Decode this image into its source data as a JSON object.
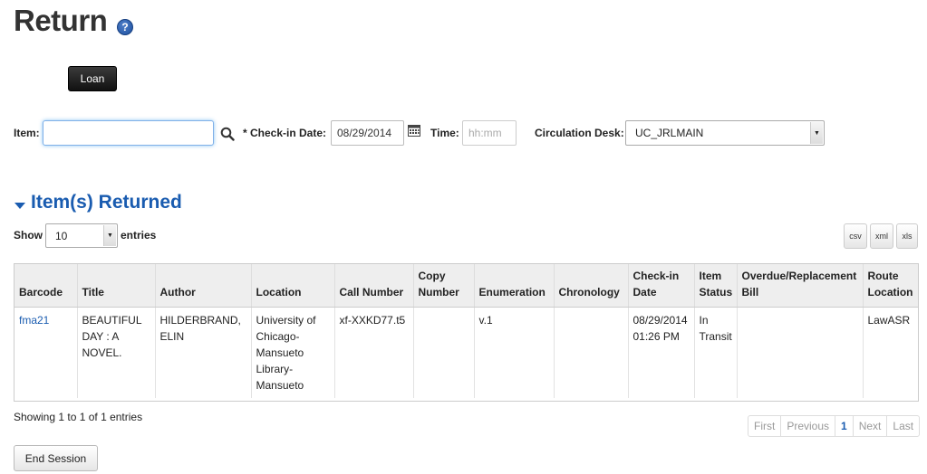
{
  "page": {
    "title": "Return",
    "help_glyph": "?"
  },
  "actions": {
    "loan_label": "Loan",
    "end_session_label": "End Session"
  },
  "form": {
    "item_label": "Item:",
    "item_value": "",
    "checkin_label": "* Check-in Date:",
    "checkin_value": "08/29/2014",
    "time_label": "Time:",
    "time_placeholder": "hh:mm",
    "desk_label": "Circulation Desk:",
    "desk_value": "UC_JRLMAIN"
  },
  "section": {
    "title": "Item(s) Returned"
  },
  "list_controls": {
    "show_label": "Show",
    "length_value": "10",
    "entries_label": "entries",
    "exports": [
      "csv",
      "xml",
      "xls"
    ]
  },
  "table": {
    "headers": [
      "Barcode",
      "Title",
      "Author",
      "Location",
      "Call Number",
      "Copy Number",
      "Enumeration",
      "Chronology",
      "Check-in Date",
      "Item Status",
      "Overdue/Replacement Bill",
      "Route Location"
    ],
    "rows": [
      {
        "barcode": "fma21",
        "title": "BEAUTIFUL DAY : A NOVEL.",
        "author": "HILDERBRAND, ELIN",
        "location": "University of Chicago-Mansueto Library-Mansueto",
        "call_number": "xf-XXKD77.t5",
        "copy_number": "",
        "enumeration": "v.1",
        "chronology": "",
        "checkin_date": "08/29/2014 01:26 PM",
        "item_status": "In Transit",
        "bill": "",
        "route_location": "LawASR"
      }
    ]
  },
  "footer": {
    "info": "Showing 1 to 1 of 1 entries",
    "pagination": {
      "first": "First",
      "previous": "Previous",
      "current": "1",
      "next": "Next",
      "last": "Last"
    }
  },
  "icons": {
    "help": "help-icon",
    "search": "search-icon",
    "calendar": "calendar-icon",
    "collapse": "triangle-down-icon",
    "select_arrow": "chevron-down-icon"
  },
  "colors": {
    "accent": "#1a5cb0",
    "button_dark": "#111111"
  }
}
